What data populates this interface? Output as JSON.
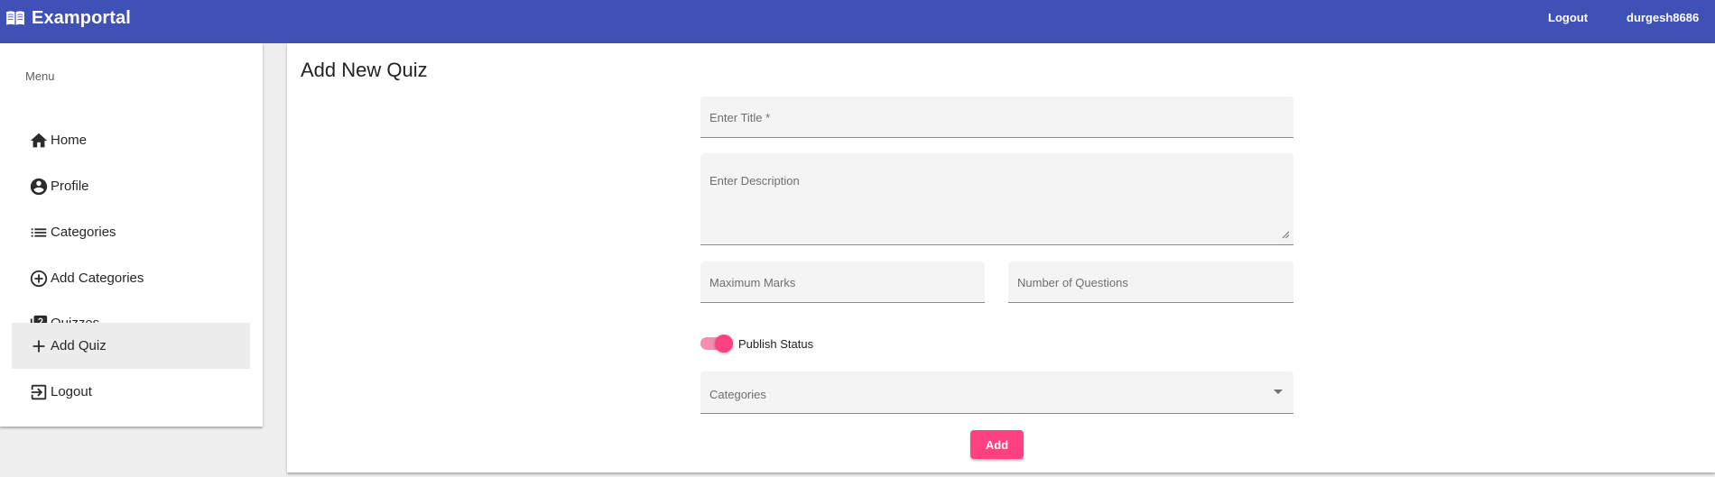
{
  "header": {
    "app_title": "Examportal",
    "logo_icon": "book-open-icon",
    "logout_label": "Logout",
    "username": "durgesh8686",
    "bg_color": "#3f51b5"
  },
  "sidebar": {
    "heading": "Menu",
    "items": [
      {
        "label": "Home",
        "icon": "home-icon"
      },
      {
        "label": "Profile",
        "icon": "account-circle-icon"
      },
      {
        "label": "Categories",
        "icon": "list-icon"
      },
      {
        "label": "Add Categories",
        "icon": "add-circle-outline-icon"
      },
      {
        "label": "Quizzes",
        "icon": "quiz-library-icon"
      },
      {
        "label": "Add Quiz",
        "icon": "add-icon",
        "active": true
      },
      {
        "label": "Logout",
        "icon": "logout-icon"
      }
    ]
  },
  "form": {
    "page_title": "Add New Quiz",
    "title_placeholder": "Enter Title *",
    "description_placeholder": "Enter Description",
    "max_marks_placeholder": "Maximum Marks",
    "num_questions_placeholder": "Number of Questions",
    "publish_label": "Publish Status",
    "publish_checked": true,
    "categories_placeholder": "Categories",
    "submit_label": "Add",
    "accent_color": "#ff4081"
  }
}
